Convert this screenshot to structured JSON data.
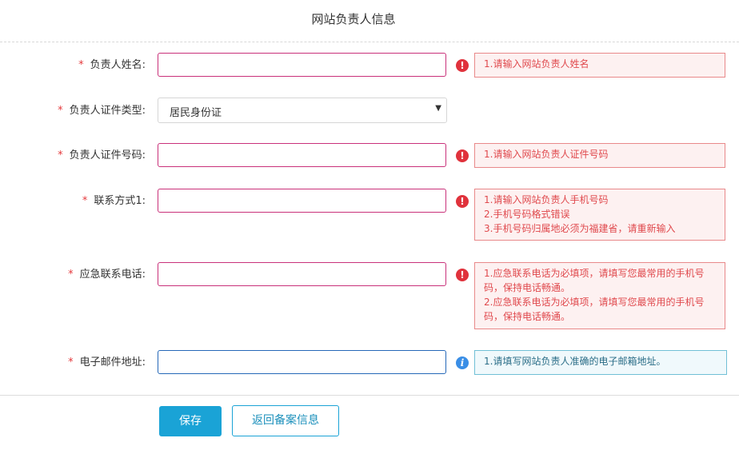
{
  "title": "网站负责人信息",
  "fields": [
    {
      "star": "*",
      "label": "负责人姓名:",
      "errors": [
        "1.请输入网站负责人姓名"
      ]
    },
    {
      "star": "*",
      "label": "负责人证件类型:",
      "selected": "居民身份证"
    },
    {
      "star": "*",
      "label": "负责人证件号码:",
      "errors": [
        "1.请输入网站负责人证件号码"
      ]
    },
    {
      "star": "*",
      "label": "联系方式1:",
      "errors": [
        "1.请输入网站负责人手机号码",
        "2.手机号码格式错误",
        "3.手机号码归属地必须为福建省，请重新输入"
      ]
    },
    {
      "star": "*",
      "label": "应急联系电话:",
      "errors": [
        "1.应急联系电话为必填项，请填写您最常用的手机号码，保持电话畅通。",
        "2.应急联系电话为必填项，请填写您最常用的手机号码，保持电话畅通。"
      ]
    },
    {
      "star": "*",
      "label": "电子邮件地址:",
      "info": [
        "1.请填写网站负责人准确的电子邮箱地址。"
      ]
    }
  ],
  "icons": {
    "error": "!",
    "info": "i"
  },
  "buttons": {
    "save": "保存",
    "back": "返回备案信息"
  },
  "colors": {
    "error_border": "#c9317a",
    "error_icon": "#e0323c",
    "info_border": "#2568b8",
    "primary": "#1aa3d6"
  }
}
